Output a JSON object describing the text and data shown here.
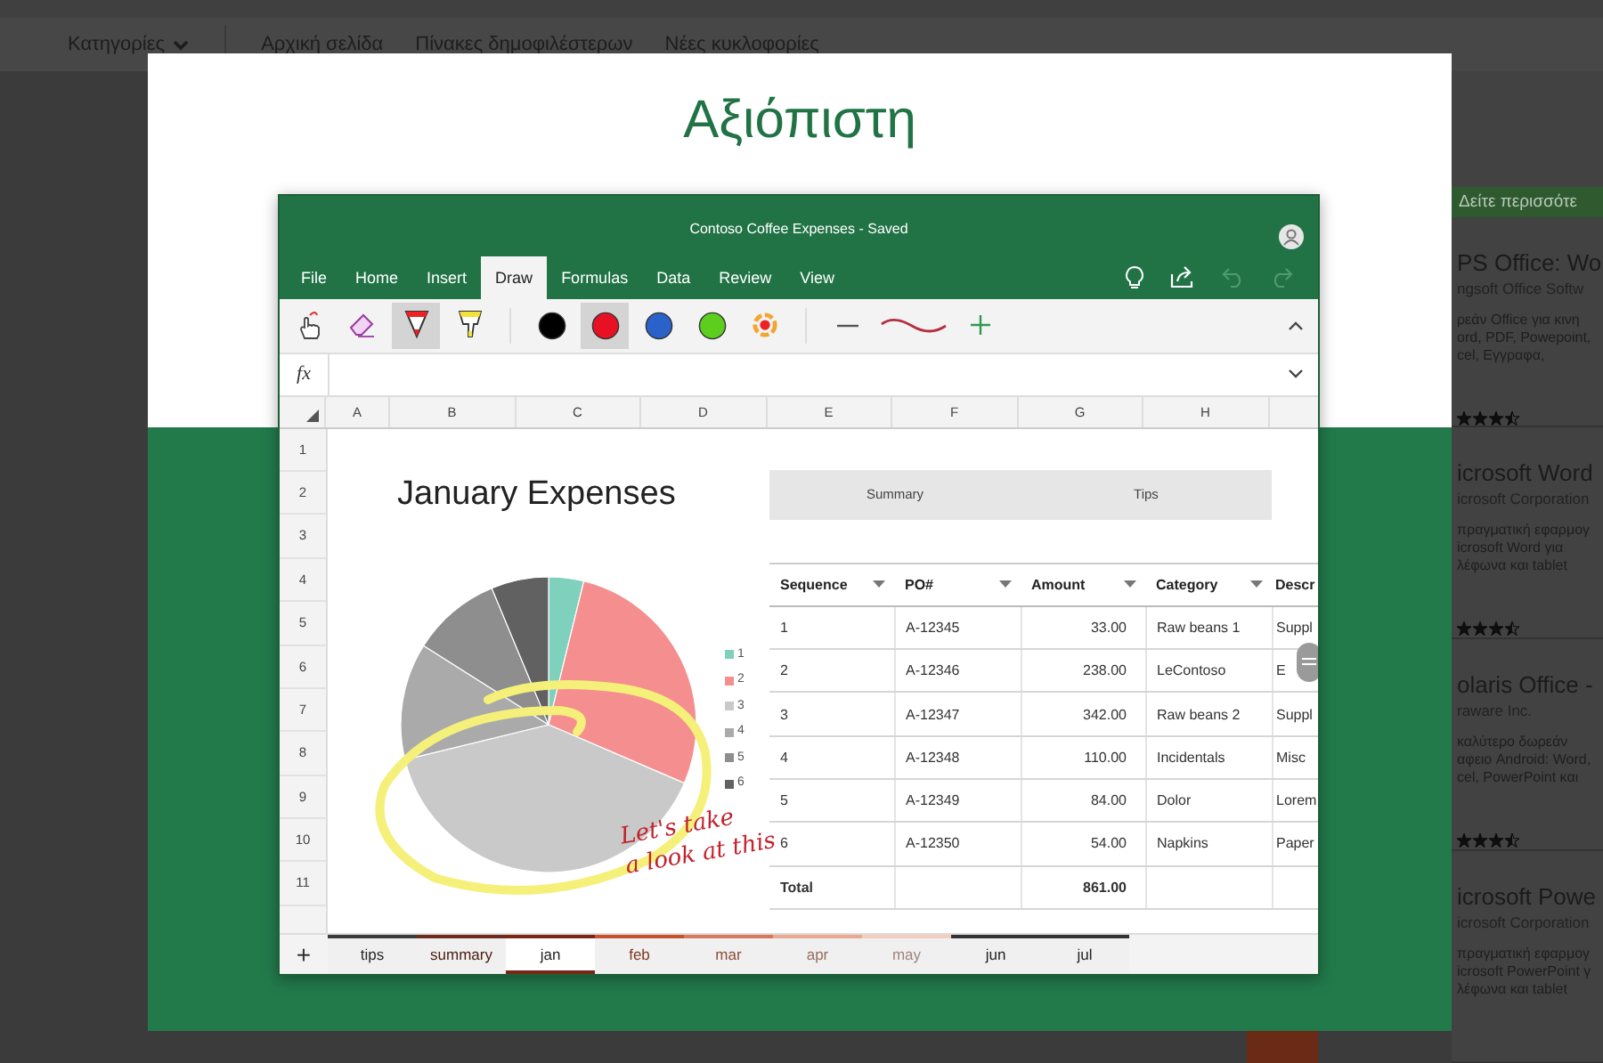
{
  "page_nav": {
    "categories": "Κατηγορίες",
    "links": [
      "Αρχική σελίδα",
      "Πίνακες δημοφιλέστερων",
      "Νέες κυκλοφορίες"
    ]
  },
  "sidebar": {
    "more_button": "Δείτε περισσότε",
    "apps": [
      {
        "title": "PS Office: Wo",
        "publisher": "ngsoft Office Softw",
        "description": [
          "ρεάν Office για κινη",
          "ord, PDF, Powepoint,",
          "cel, Εγγραφα,"
        ],
        "stars": 3.5
      },
      {
        "title": "icrosoft Word",
        "publisher": "icrosoft Corporation",
        "description": [
          "πραγματική εφαρμογ",
          "icrosoft Word για",
          "λέφωνα και tablet"
        ],
        "stars": 3.5
      },
      {
        "title": "olaris Office -",
        "publisher": "raware Inc.",
        "description": [
          "καλύτερο δωρεάν",
          "αφειο Android: Word,",
          "cel, PowerPoint και"
        ],
        "stars": 3.5
      },
      {
        "title": "icrosoft Powe",
        "publisher": "icrosoft Corporation",
        "description": [
          "πραγματική εφαρμογ",
          "icrosoft PowerPoint γ",
          "λέφωνα και tablet"
        ]
      }
    ]
  },
  "modal": {
    "title": "Αξιόπιστη"
  },
  "excel": {
    "title": "Contoso Coffee Expenses - Saved",
    "tabs": [
      {
        "label": "File",
        "selected": false
      },
      {
        "label": "Home",
        "selected": false
      },
      {
        "label": "Insert",
        "selected": false
      },
      {
        "label": "Draw",
        "selected": true
      },
      {
        "label": "Formulas",
        "selected": false
      },
      {
        "label": "Data",
        "selected": false
      },
      {
        "label": "Review",
        "selected": false
      },
      {
        "label": "View",
        "selected": false
      }
    ],
    "actions": [
      {
        "kind": "idea",
        "disabled": false
      },
      {
        "kind": "share",
        "disabled": false
      },
      {
        "kind": "undo",
        "disabled": true
      },
      {
        "kind": "redo",
        "disabled": true
      }
    ],
    "ink_tools": [
      {
        "kind": "touch",
        "selected": false
      },
      {
        "kind": "eraser",
        "selected": false
      },
      {
        "kind": "pen",
        "selected": true
      },
      {
        "kind": "highlighter",
        "selected": false
      }
    ],
    "pen_colors": [
      {
        "color": "#000000",
        "selected": false
      },
      {
        "color": "#e81123",
        "selected": true
      },
      {
        "color": "#2b62c9",
        "selected": false
      },
      {
        "color": "#5ccf1e",
        "selected": false
      }
    ],
    "formula_label": "fx",
    "columns": [
      "A",
      "B",
      "C",
      "D",
      "E",
      "F",
      "G",
      "H"
    ],
    "rows": [
      "1",
      "2",
      "3",
      "4",
      "5",
      "6",
      "7",
      "8",
      "9",
      "10",
      "11"
    ],
    "chart": {
      "title": "January Expenses",
      "legend": [
        {
          "label": "1",
          "color": "#7fd0bd"
        },
        {
          "label": "2",
          "color": "#f58f8f"
        },
        {
          "label": "3",
          "color": "#c9c9c9"
        },
        {
          "label": "4",
          "color": "#aaaaaa"
        },
        {
          "label": "5",
          "color": "#8e8e8e"
        },
        {
          "label": "6",
          "color": "#616161"
        }
      ]
    },
    "links": [
      "Summary",
      "Tips"
    ],
    "table": {
      "columns": [
        {
          "label": "Sequence",
          "filter": true
        },
        {
          "label": "PO#",
          "filter": true
        },
        {
          "label": "Amount",
          "filter": true
        },
        {
          "label": "Category",
          "filter": true
        },
        {
          "label": "Descr",
          "filter": false
        }
      ],
      "rows": [
        {
          "sequence": "1",
          "po": "A-12345",
          "amount": "33.00",
          "category": "Raw beans 1",
          "description": "Suppl"
        },
        {
          "sequence": "2",
          "po": "A-12346",
          "amount": "238.00",
          "category": "LeContoso",
          "description": "E"
        },
        {
          "sequence": "3",
          "po": "A-12347",
          "amount": "342.00",
          "category": "Raw beans 2",
          "description": "Suppl"
        },
        {
          "sequence": "4",
          "po": "A-12348",
          "amount": "110.00",
          "category": "Incidentals",
          "description": "Misc"
        },
        {
          "sequence": "5",
          "po": "A-12349",
          "amount": "84.00",
          "category": "Dolor",
          "description": "Lorem"
        },
        {
          "sequence": "6",
          "po": "A-12350",
          "amount": "54.00",
          "category": "Napkins",
          "description": "Paper"
        }
      ],
      "total": {
        "label": "Total",
        "amount": "861.00"
      }
    },
    "ink_note": "Let's take\na look at this",
    "add_sheet": "+",
    "sheets": [
      {
        "label": "tips",
        "color": "#3a3a3a",
        "selected": false
      },
      {
        "label": "summary",
        "color": "#6e2a1c",
        "selected": false
      },
      {
        "label": "jan",
        "color": "#7b2614",
        "selected": true
      },
      {
        "label": "feb",
        "color": "#c4522f",
        "selected": false
      },
      {
        "label": "mar",
        "color": "#d9785a",
        "selected": false
      },
      {
        "label": "apr",
        "color": "#eaa88e",
        "selected": false
      },
      {
        "label": "may",
        "color": "#f4cdbd",
        "selected": false
      },
      {
        "label": "jun",
        "color": "#333333",
        "selected": false
      },
      {
        "label": "jul",
        "color": "#333333",
        "selected": false
      }
    ]
  }
}
